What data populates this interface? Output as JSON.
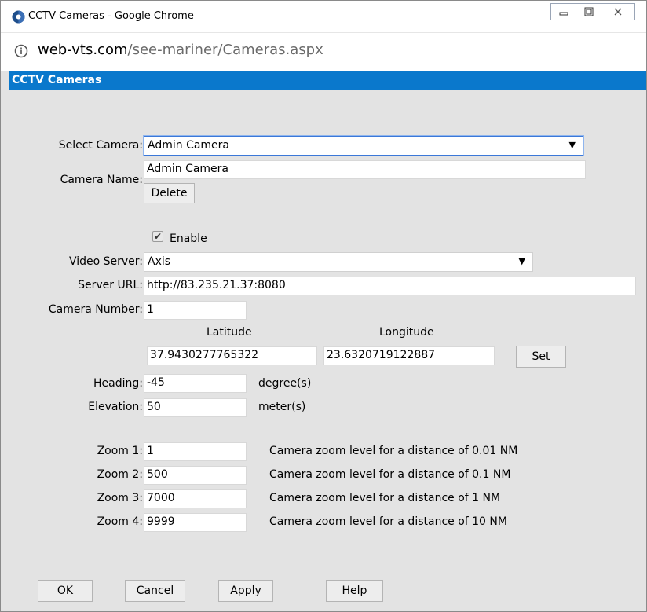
{
  "window": {
    "title": "CCTV Cameras - Google Chrome",
    "url_domain": "web-vts.com",
    "url_path": "/see-mariner/Cameras.aspx"
  },
  "header": {
    "title": "CCTV Cameras"
  },
  "form": {
    "select_camera_label": "Select Camera:",
    "select_camera_value": "Admin Camera",
    "camera_name_label": "Camera Name:",
    "camera_name_value": "Admin Camera",
    "delete_label": "Delete",
    "enable_label": "Enable",
    "enable_checked": true,
    "video_server_label": "Video Server:",
    "video_server_value": "Axis",
    "server_url_label": "Server URL:",
    "server_url_value": "http://83.235.21.37:8080",
    "camera_number_label": "Camera Number:",
    "camera_number_value": "1",
    "latitude_label": "Latitude",
    "longitude_label": "Longitude",
    "latitude_value": "37.9430277765322",
    "longitude_value": "23.6320719122887",
    "set_label": "Set",
    "heading_label": "Heading:",
    "heading_value": "-45",
    "heading_unit": "degree(s)",
    "elevation_label": "Elevation:",
    "elevation_value": "50",
    "elevation_unit": "meter(s)",
    "zooms": [
      {
        "label": "Zoom 1:",
        "value": "1",
        "desc": "Camera zoom level for a distance of 0.01 NM"
      },
      {
        "label": "Zoom 2:",
        "value": "500",
        "desc": "Camera zoom level for a distance of 0.1 NM"
      },
      {
        "label": "Zoom 3:",
        "value": "7000",
        "desc": "Camera zoom level for a distance of 1 NM"
      },
      {
        "label": "Zoom 4:",
        "value": "9999",
        "desc": "Camera zoom level for a distance of 10 NM"
      }
    ]
  },
  "footer": {
    "ok_label": "OK",
    "cancel_label": "Cancel",
    "apply_label": "Apply",
    "help_label": "Help"
  }
}
